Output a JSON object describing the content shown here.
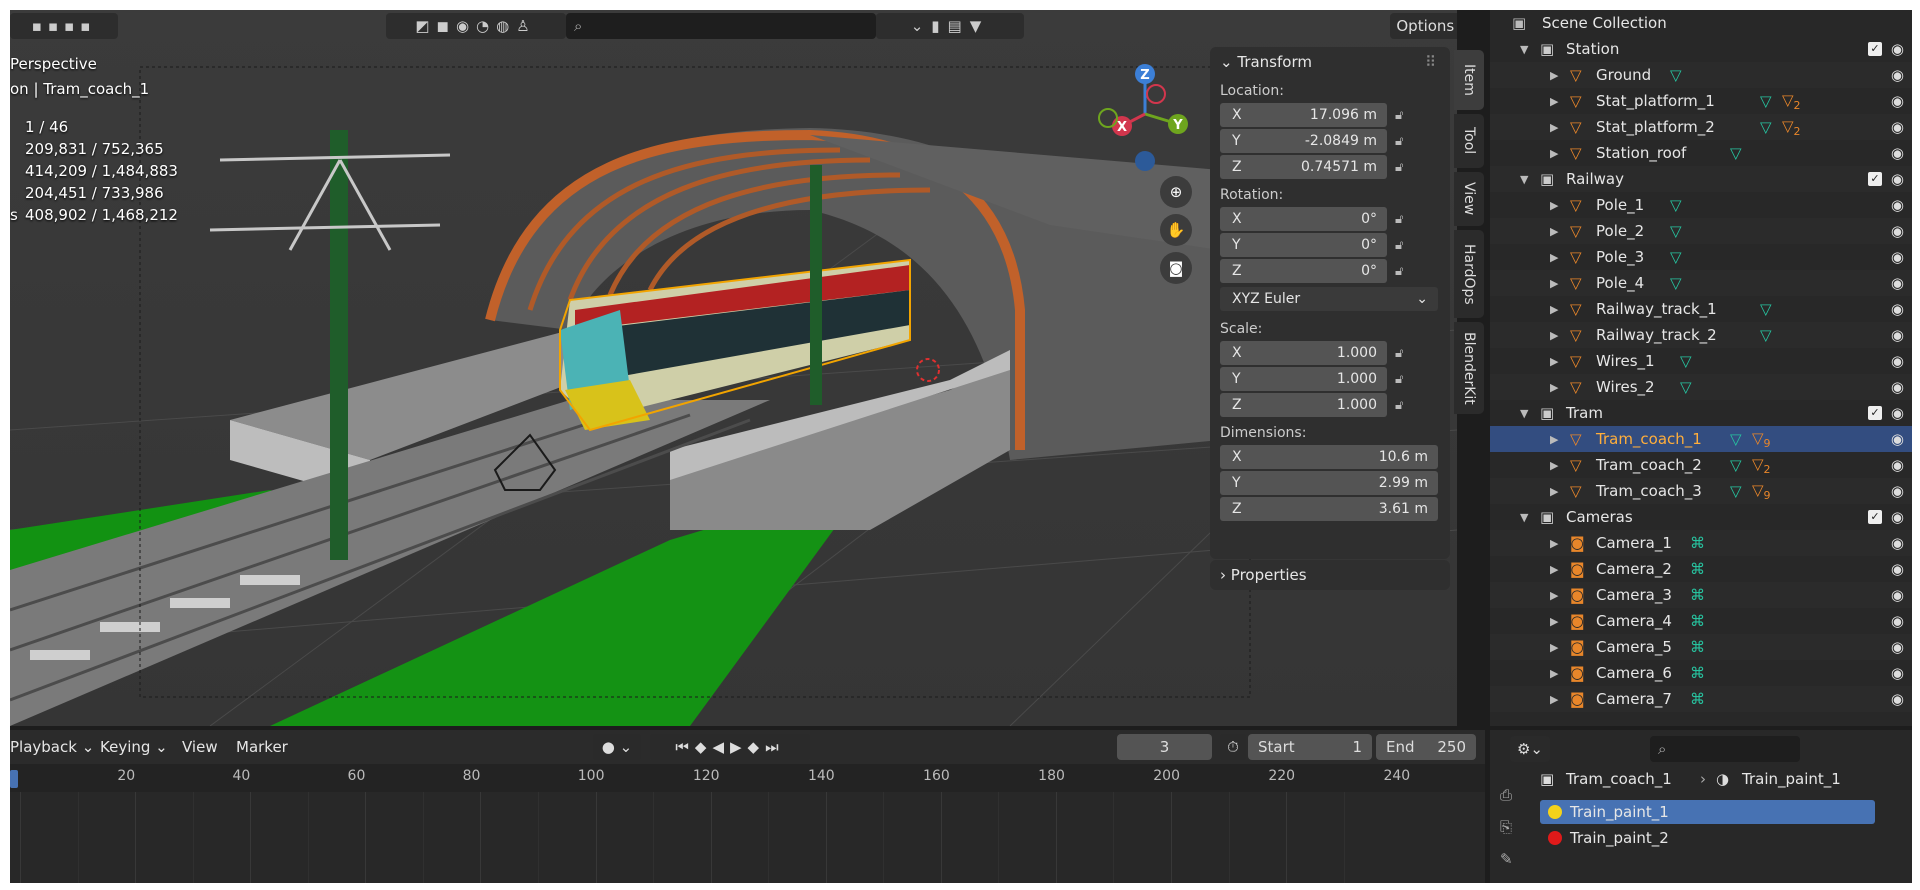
{
  "viewport": {
    "view_name": "Perspective",
    "collection_path": "on | Tram_coach_1",
    "stats": [
      "1 / 46",
      "209,831 / 752,365",
      "414,209 / 1,484,883",
      "204,451 / 733,986",
      "408,902 / 1,468,212"
    ],
    "stats_prefix": "s",
    "options_label": "Options",
    "gizmo": {
      "x": "X",
      "y": "Y",
      "z": "Z"
    }
  },
  "side_tabs": [
    "Item",
    "Tool",
    "View",
    "HardOps",
    "BlenderKit"
  ],
  "transform": {
    "title": "Transform",
    "location_label": "Location:",
    "location": [
      {
        "axis": "X",
        "value": "17.096 m"
      },
      {
        "axis": "Y",
        "value": "-2.0849 m"
      },
      {
        "axis": "Z",
        "value": "0.74571 m"
      }
    ],
    "rotation_label": "Rotation:",
    "rotation": [
      {
        "axis": "X",
        "value": "0°"
      },
      {
        "axis": "Y",
        "value": "0°"
      },
      {
        "axis": "Z",
        "value": "0°"
      }
    ],
    "rotation_mode": "XYZ Euler",
    "scale_label": "Scale:",
    "scale": [
      {
        "axis": "X",
        "value": "1.000"
      },
      {
        "axis": "Y",
        "value": "1.000"
      },
      {
        "axis": "Z",
        "value": "1.000"
      }
    ],
    "dimensions_label": "Dimensions:",
    "dimensions": [
      {
        "axis": "X",
        "value": "10.6 m"
      },
      {
        "axis": "Y",
        "value": "2.99 m"
      },
      {
        "axis": "Z",
        "value": "3.61 m"
      }
    ],
    "properties_title": "Properties"
  },
  "outliner": {
    "root": "Scene Collection",
    "rows": [
      {
        "label": "Station",
        "kind": "collection"
      },
      {
        "label": "Ground",
        "kind": "mesh"
      },
      {
        "label": "Stat_platform_1",
        "kind": "mesh",
        "mod_count": "2"
      },
      {
        "label": "Stat_platform_2",
        "kind": "mesh",
        "mod_count": "2"
      },
      {
        "label": "Station_roof",
        "kind": "mesh"
      },
      {
        "label": "Railway",
        "kind": "collection"
      },
      {
        "label": "Pole_1",
        "kind": "mesh"
      },
      {
        "label": "Pole_2",
        "kind": "mesh"
      },
      {
        "label": "Pole_3",
        "kind": "mesh"
      },
      {
        "label": "Pole_4",
        "kind": "mesh"
      },
      {
        "label": "Railway_track_1",
        "kind": "mesh"
      },
      {
        "label": "Railway_track_2",
        "kind": "mesh"
      },
      {
        "label": "Wires_1",
        "kind": "mesh"
      },
      {
        "label": "Wires_2",
        "kind": "mesh"
      },
      {
        "label": "Tram",
        "kind": "collection"
      },
      {
        "label": "Tram_coach_1",
        "kind": "mesh",
        "mod_count": "9",
        "selected": true
      },
      {
        "label": "Tram_coach_2",
        "kind": "mesh",
        "mod_count": "2"
      },
      {
        "label": "Tram_coach_3",
        "kind": "mesh",
        "mod_count": "9"
      },
      {
        "label": "Cameras",
        "kind": "collection"
      },
      {
        "label": "Camera_1",
        "kind": "camera"
      },
      {
        "label": "Camera_2",
        "kind": "camera"
      },
      {
        "label": "Camera_3",
        "kind": "camera"
      },
      {
        "label": "Camera_4",
        "kind": "camera"
      },
      {
        "label": "Camera_5",
        "kind": "camera"
      },
      {
        "label": "Camera_6",
        "kind": "camera"
      },
      {
        "label": "Camera_7",
        "kind": "camera"
      }
    ]
  },
  "timeline": {
    "playback": "Playback",
    "keying": "Keying",
    "view": "View",
    "marker": "Marker",
    "current_frame": "3",
    "start_label": "Start",
    "start": "1",
    "end_label": "End",
    "end": "250",
    "ruler": [
      "20",
      "40",
      "60",
      "80",
      "100",
      "120",
      "140",
      "160",
      "180",
      "200",
      "220",
      "240"
    ]
  },
  "properties": {
    "object": "Tram_coach_1",
    "material": "Train_paint_1",
    "slots": [
      {
        "name": "Train_paint_1",
        "color": "#f4d21a",
        "selected": true
      },
      {
        "name": "Train_paint_2",
        "color": "#e01a1a"
      }
    ]
  }
}
